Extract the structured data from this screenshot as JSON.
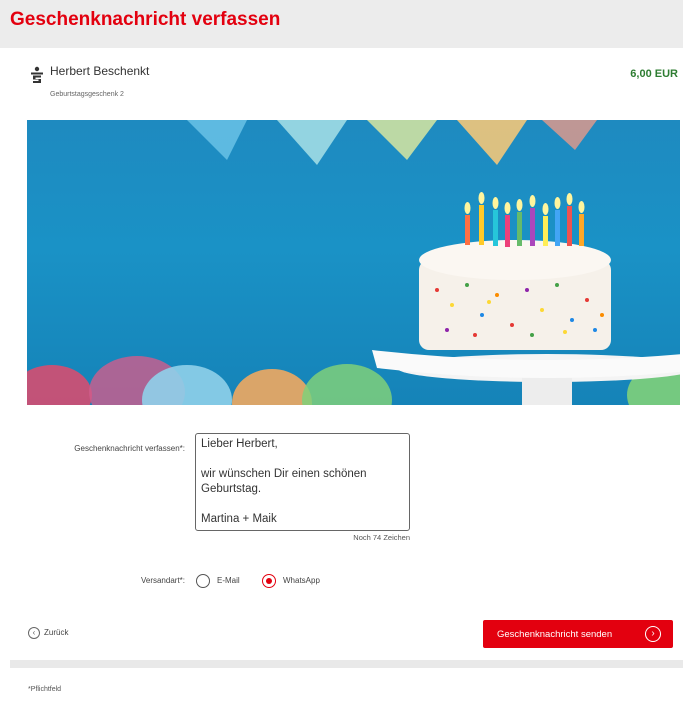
{
  "page": {
    "title": "Geschenknachricht verfassen"
  },
  "product": {
    "icon": "sparkasse-logo-icon",
    "name": "Herbert Beschenkt",
    "subtitle": "Geburtstagsgeschenk 2",
    "price": "6,00 EUR"
  },
  "banner": {
    "icon": "birthday-cake-image"
  },
  "form": {
    "message_label": "Geschenknachricht verfassen*:",
    "message_lines": [
      "Lieber Herbert,",
      "",
      "wir wünschen Dir einen schönen",
      "Geburtstag.",
      "",
      "Martina + Maik"
    ],
    "counter": "Noch 74 Zeichen",
    "send_via_label": "Versandart*:",
    "options": [
      {
        "label": "E-Mail",
        "selected": false
      },
      {
        "label": "WhatsApp",
        "selected": true
      }
    ]
  },
  "actions": {
    "back_label": "Zurück",
    "back_icon": "chevron-left-circle-icon",
    "send_label": "Geschenknachricht senden",
    "send_icon": "chevron-right-circle-icon"
  },
  "footer": {
    "note": "*Pflichtfeld"
  },
  "colors": {
    "accent": "#e3000f",
    "price": "#2e7d32",
    "banner_bg": "#1a92c6"
  }
}
